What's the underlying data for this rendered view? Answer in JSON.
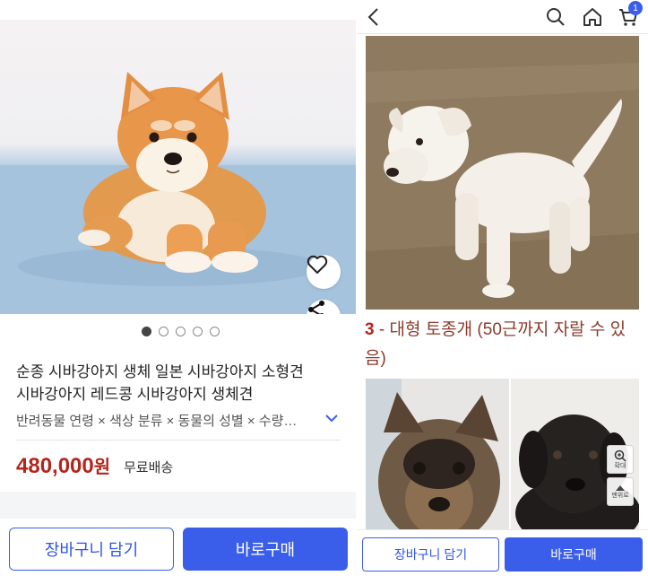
{
  "left": {
    "product": {
      "title_line1": "순종 시바강아지 생체 일본 시바강아지 소형견",
      "title_line2": "시바강아지 레드콩 시바강아지 생체견",
      "options": "반려동물 연령 × 색상 분류 × 동물의 성별 × 수량…",
      "price": "480,000",
      "currency": "원",
      "shipping": "무료배송"
    },
    "carousel": {
      "total": 5,
      "active_index": 0
    },
    "icons": {
      "wishlist": "heart-icon",
      "share": "share-icon",
      "options_expand": "chevron-down-icon"
    },
    "actions": {
      "cart_label": "장바구니 담기",
      "buy_label": "바로구매"
    }
  },
  "right": {
    "topbar": {
      "icons": [
        "back-icon",
        "search-icon",
        "home-icon",
        "cart-icon"
      ],
      "cart_count": "1"
    },
    "caption": {
      "number": "3",
      "text": " - 대형 토종개 (50근까지 자랄 수 있음)"
    },
    "zoom": {
      "zoom_label": "확대",
      "top_label": "맨위로"
    },
    "actions": {
      "cart_label": "장바구니 담기",
      "buy_label": "바로구매"
    }
  },
  "colors": {
    "accent": "#3a5ee9",
    "price": "#b3261e",
    "caption": "#8a3b2c"
  }
}
